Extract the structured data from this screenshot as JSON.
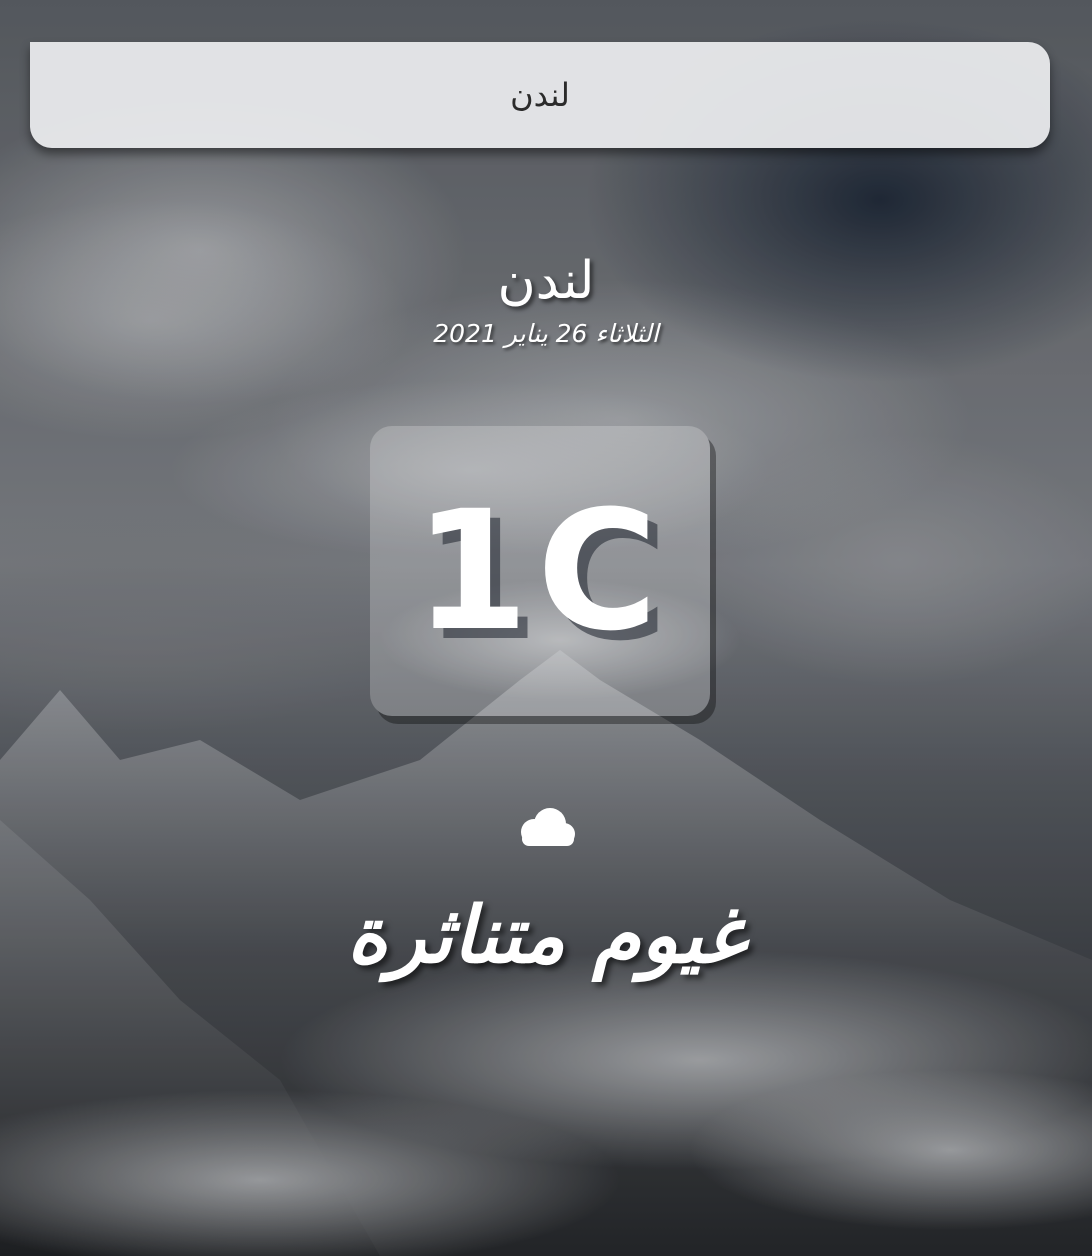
{
  "search": {
    "value": "لندن",
    "placeholder": ""
  },
  "location": {
    "city": "لندن",
    "date": "الثلاثاء 26 يناير 2021"
  },
  "weather": {
    "temperature": "1C",
    "condition": "غيوم متناثرة",
    "icon": "cloud-icon"
  },
  "colors": {
    "search_bg": "#eceded",
    "text": "#ffffff",
    "card_bg": "rgba(255,255,255,0.22)"
  }
}
